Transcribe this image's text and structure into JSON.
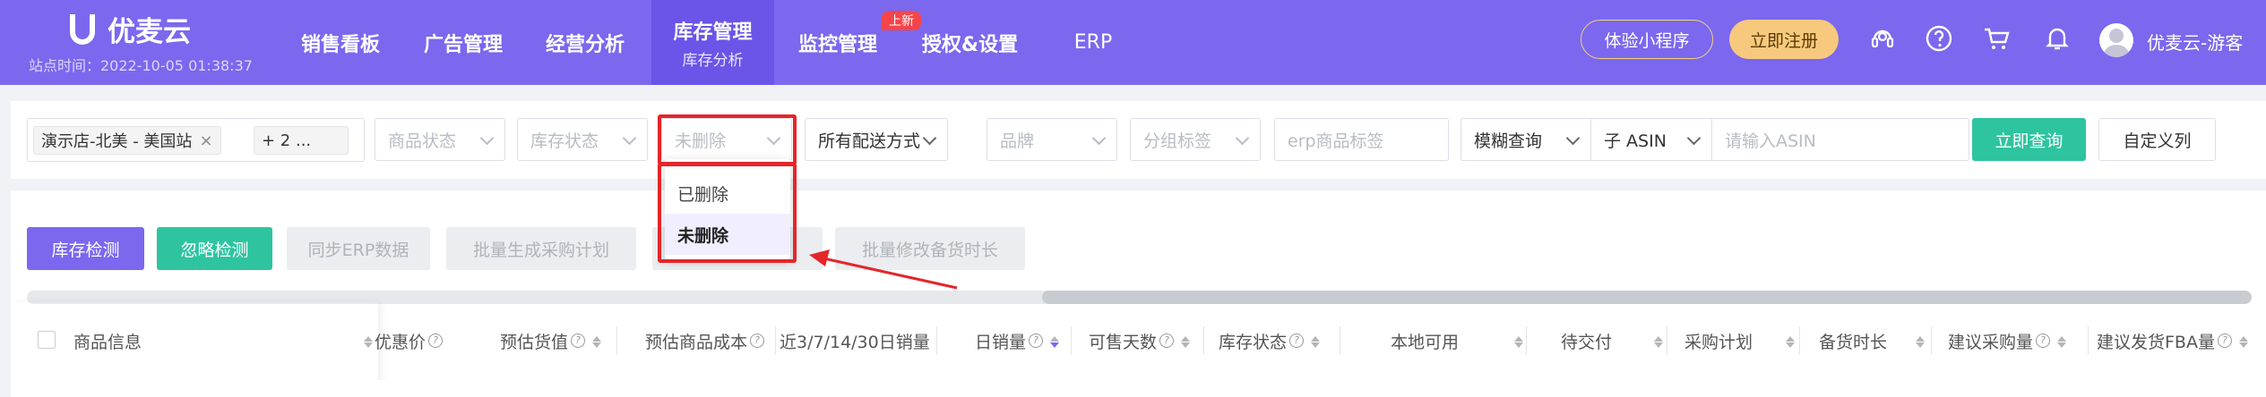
{
  "header": {
    "logo_text": "优麦云",
    "site_time": "站点时间：2022-10-05 01:38:37",
    "nav": [
      {
        "label": "销售看板"
      },
      {
        "label": "广告管理"
      },
      {
        "label": "经营分析"
      },
      {
        "label": "库存管理",
        "sub": "库存分析",
        "active": true
      },
      {
        "label": "监控管理",
        "badge": "上新"
      },
      {
        "label": "授权&设置"
      },
      {
        "label": "ERP"
      }
    ],
    "mini_program_btn": "体验小程序",
    "register_btn": "立即注册",
    "icons": [
      "headset-icon",
      "help-icon",
      "cart-icon",
      "bell-icon"
    ],
    "username": "优麦云-游客"
  },
  "filters": {
    "store_tag": "演示店-北美 - 美国站",
    "more_tag": "+ 2 ...",
    "product_status": "商品状态",
    "stock_status": "库存状态",
    "delete_status": "未删除",
    "delivery": "所有配送方式",
    "brand": "品牌",
    "group_tag": "分组标签",
    "erp_tag_placeholder": "erp商品标签",
    "search_mode": "模糊查询",
    "asin_type": "子 ASIN",
    "asin_placeholder": "请输入ASIN",
    "query_btn": "立即查询",
    "custom_cols_btn": "自定义列"
  },
  "delete_dropdown": {
    "options": [
      "已删除",
      "未删除"
    ],
    "selected": "未删除"
  },
  "actions": {
    "check_btn": "库存检测",
    "ignore_btn": "忽略检测",
    "sync_erp": "同步ERP数据",
    "batch_purchase": "批量生成采购计划",
    "batch_stock_time": "批量修改备货时长"
  },
  "table": {
    "columns": [
      "商品信息",
      "优惠价",
      "预估货值",
      "预估商品成本",
      "近3/7/14/30日销量",
      "日销量",
      "可售天数",
      "库存状态",
      "本地可用",
      "待交付",
      "采购计划",
      "备货时长",
      "建议采购量",
      "建议发货FBA量"
    ]
  },
  "colors": {
    "brand": "#7b68ee",
    "teal": "#2ec4a0",
    "highlight": "#e4262a"
  }
}
